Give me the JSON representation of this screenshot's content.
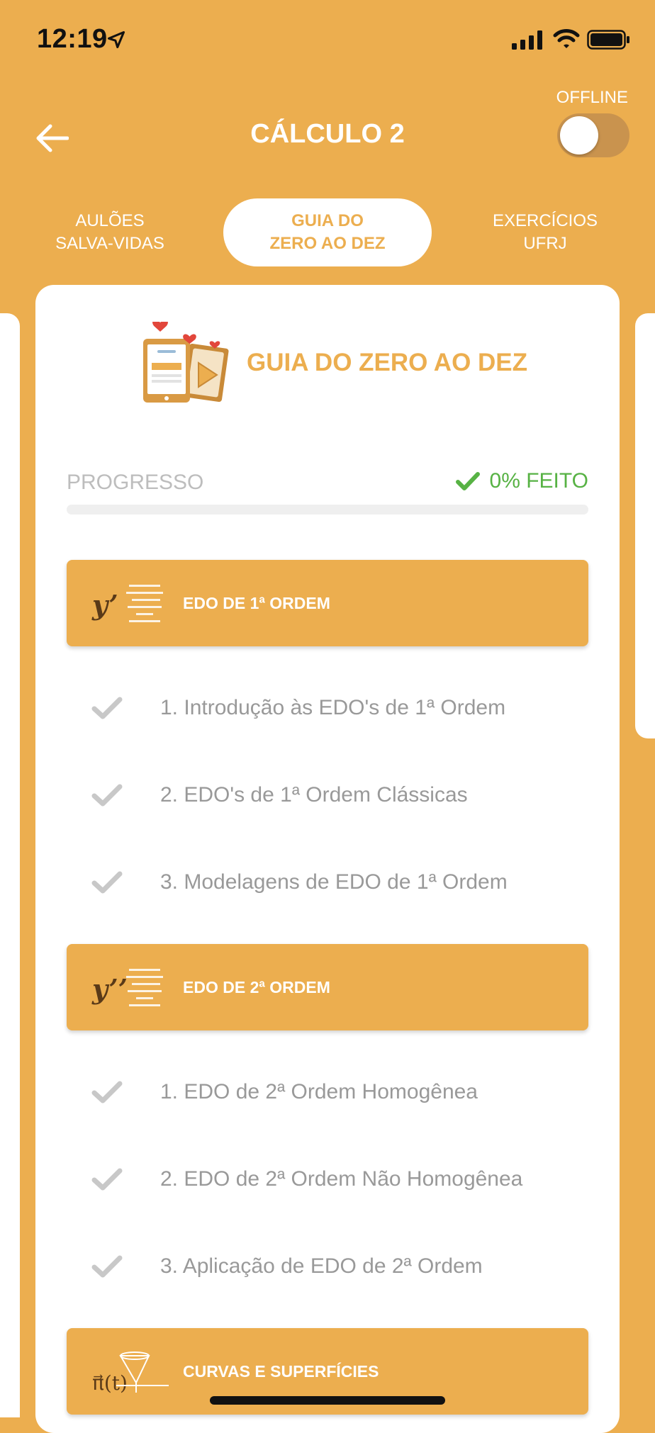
{
  "status_bar": {
    "time": "12:19"
  },
  "header": {
    "title": "CÁLCULO 2",
    "offline_label": "OFFLINE",
    "offline_enabled": false
  },
  "tabs": [
    {
      "line1": "AULÕES",
      "line2": "SALVA-VIDAS",
      "active": false
    },
    {
      "line1": "GUIA DO",
      "line2": "ZERO AO DEZ",
      "active": true
    },
    {
      "line1": "EXERCÍCIOS",
      "line2": "UFRJ",
      "active": false
    }
  ],
  "guide": {
    "heading": "GUIA DO ZERO AO DEZ",
    "progress_label": "PROGRESSO",
    "progress_status": "0% FEITO",
    "progress_fraction": 0
  },
  "sections": [
    {
      "title": "EDO DE 1ª ORDEM",
      "icon": "y-prime",
      "icon_text": "y’",
      "lessons": [
        "1. Introdução às EDO's de 1ª Ordem",
        "2. EDO's de 1ª Ordem Clássicas",
        "3. Modelagens de EDO de 1ª Ordem"
      ]
    },
    {
      "title": "EDO DE 2ª ORDEM",
      "icon": "y-double-prime",
      "icon_text": "y’’",
      "lessons": [
        "1. EDO de 2ª Ordem Homogênea",
        "2. EDO de 2ª Ordem Não Homogênea",
        "3. Aplicação de EDO de 2ª Ordem"
      ]
    },
    {
      "title": "CURVAS E SUPERFÍCIES",
      "icon": "pi-vector",
      "icon_text": "π⃗(t)",
      "lessons": []
    }
  ],
  "colors": {
    "accent": "#ECAE4F",
    "done_green": "#57B244",
    "check_gray": "#C8C8C8",
    "text_gray": "#999999"
  }
}
